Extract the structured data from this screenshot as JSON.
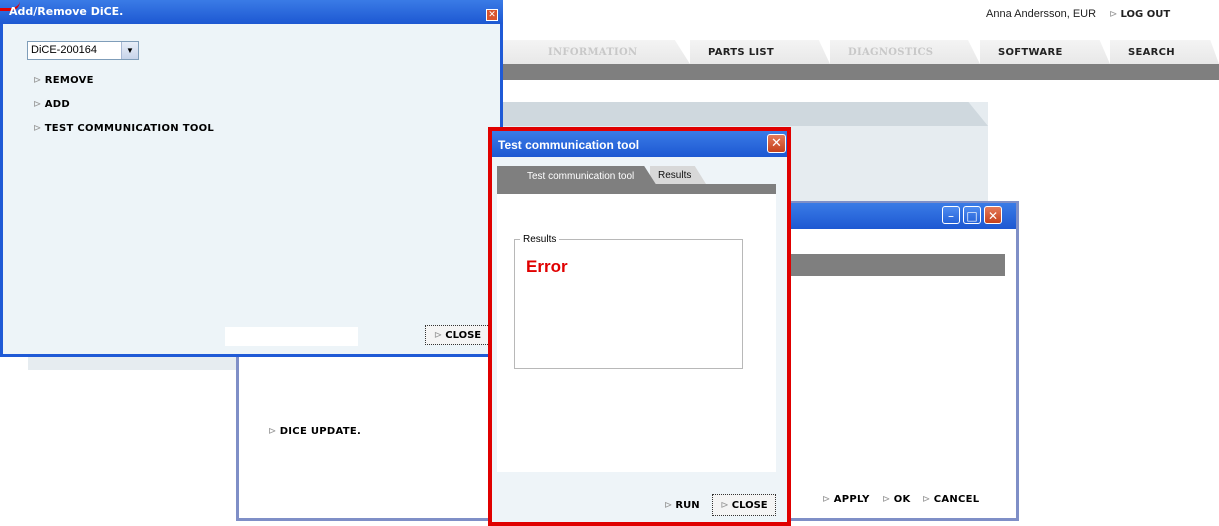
{
  "header": {
    "user": "Anna Andersson, EUR",
    "logout": "LOG OUT"
  },
  "tabs": [
    {
      "label": "INFORMATION",
      "state": "disabled"
    },
    {
      "label": "PARTS LIST",
      "state": "active"
    },
    {
      "label": "DIAGNOSTICS",
      "state": "disabled"
    },
    {
      "label": "SOFTWARE",
      "state": "active"
    },
    {
      "label": "SEARCH",
      "state": "active"
    }
  ],
  "dice_window": {
    "title": "Add/Remove DiCE.",
    "selected_device": "DiCE-200164",
    "links": [
      "REMOVE",
      "ADD",
      "TEST COMMUNICATION TOOL"
    ],
    "close": "CLOSE"
  },
  "settings_window": {
    "dice_update": "DICE UPDATE.",
    "apply": "APPLY",
    "ok": "OK",
    "cancel": "CANCEL"
  },
  "test_dialog": {
    "title": "Test communication tool",
    "tabs": [
      "Test communication tool",
      "Results"
    ],
    "results_label": "Results",
    "results_value": "Error",
    "run": "RUN",
    "close": "CLOSE"
  },
  "colors": {
    "titlebar_blue": "#1d58d2",
    "highlight_red": "#e00000",
    "error_red": "#e00000",
    "panel_bg": "#edf4f8"
  }
}
